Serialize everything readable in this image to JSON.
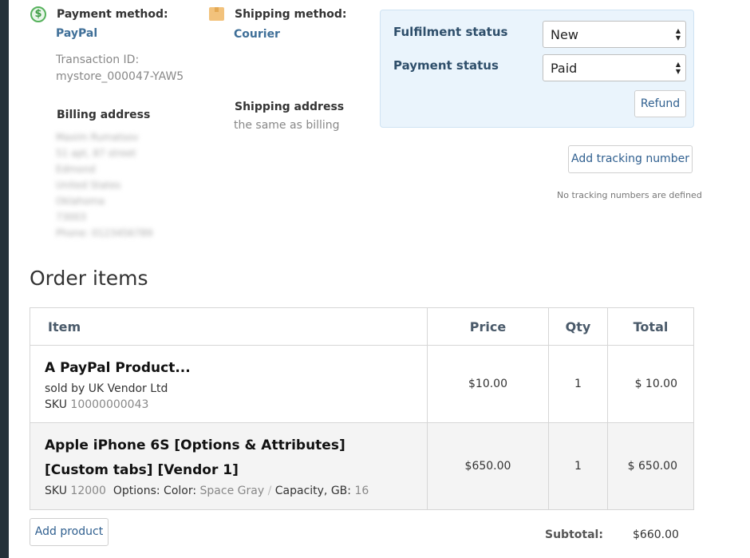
{
  "payment": {
    "label": "Payment method:",
    "value": "PayPal",
    "txn_label": "Transaction ID:",
    "txn_value": "mystore_000047-YAW5",
    "icon": "dollar-icon"
  },
  "shipping": {
    "label": "Shipping method:",
    "value": "Courier",
    "icon": "box-icon"
  },
  "billing": {
    "label": "Billing address",
    "lines": [
      "Maxim Rumatsov",
      "51 apt, 87 street",
      "Edmond",
      "United States",
      "Oklahoma",
      "73003",
      "Phone: 0123456789"
    ]
  },
  "shipping_address": {
    "label": "Shipping address",
    "value": "the same as billing"
  },
  "status_panel": {
    "fulfilment_label": "Fulfilment status",
    "fulfilment_value": "New",
    "payment_label": "Payment status",
    "payment_value": "Paid",
    "refund_label": "Refund"
  },
  "tracking": {
    "add_label": "Add tracking number",
    "note": "No tracking numbers are defined"
  },
  "order_items": {
    "title": "Order items",
    "columns": [
      "Item",
      "Price",
      "Qty",
      "Total"
    ],
    "rows": [
      {
        "name": "A PayPal Product...",
        "vendor": "sold by UK Vendor Ltd",
        "sku_label": "SKU",
        "sku": "10000000043",
        "price": "$10.00",
        "qty": "1",
        "total": "$ 10.00"
      },
      {
        "name_line1": "Apple iPhone 6S [Options & Attributes]",
        "name_line2": "[Custom tabs] [Vendor 1]",
        "sku_label": "SKU",
        "sku": "12000",
        "options_label": "Options:",
        "opt1_name": "Color:",
        "opt1_value": "Space Gray",
        "sep": "/",
        "opt2_name": "Capacity, GB:",
        "opt2_value": "16",
        "price": "$650.00",
        "qty": "1",
        "total": "$ 650.00"
      }
    ]
  },
  "add_product_label": "Add product",
  "subtotal": {
    "label": "Subtotal:",
    "value": "$660.00"
  }
}
